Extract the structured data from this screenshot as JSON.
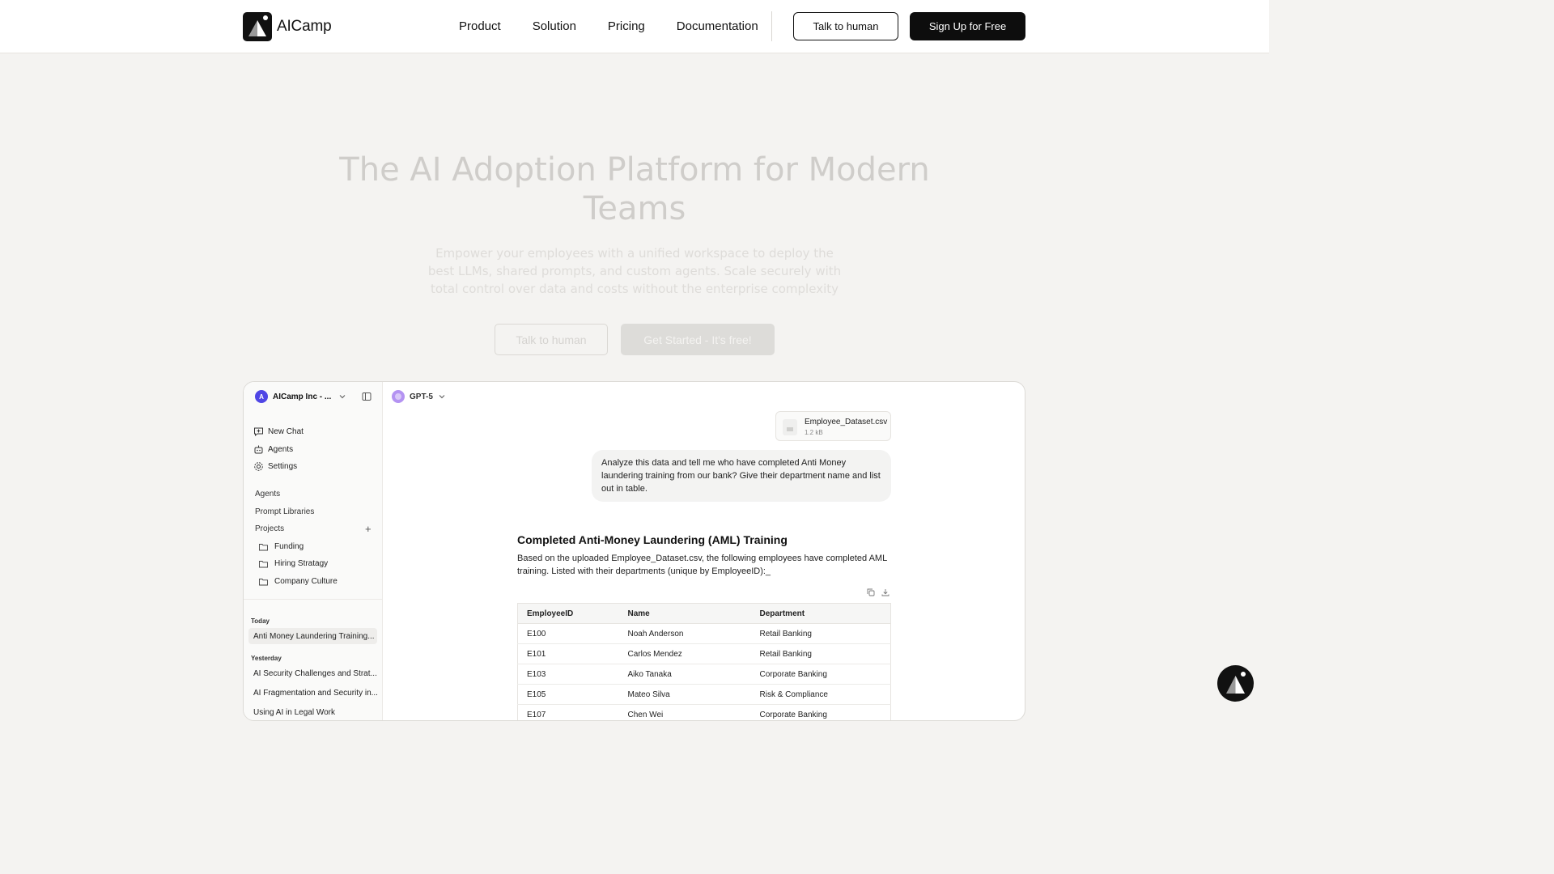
{
  "nav": {
    "brand": "AICamp",
    "links": [
      "Product",
      "Solution",
      "Pricing",
      "Documentation"
    ],
    "talk_label": "Talk to human",
    "signup_label": "Sign Up for Free"
  },
  "hero": {
    "title": "The AI Adoption Platform for Modern Teams",
    "subtitle": "Empower your employees with a unified workspace to deploy the best LLMs, shared prompts, and custom agents. Scale securely with total control over data and costs without the enterprise complexity",
    "talk_label": "Talk to human",
    "start_label": "Get Started - It's free!"
  },
  "app": {
    "workspace": "AICamp Inc - ...",
    "workspace_initial": "A",
    "nav": [
      "New Chat",
      "Agents",
      "Settings"
    ],
    "sections": [
      "Agents",
      "Prompt Libraries",
      "Projects"
    ],
    "projects": [
      "Funding",
      "Hiring Stratagy",
      "Company Culture"
    ],
    "today_label": "Today",
    "today": [
      "Anti Money Laundering Training..."
    ],
    "yesterday_label": "Yesterday",
    "yesterday": [
      "AI Security Challenges and Strat...",
      "AI Fragmentation and Security in...",
      "Using AI in Legal Work"
    ],
    "model": "GPT-5",
    "file": {
      "name": "Employee_Dataset.csv",
      "size": "1.2 kB"
    },
    "user_message": "Analyze this data and tell me who have completed Anti Money laundering training from our bank? Give their department name and list out in table.",
    "answer_title": "Completed Anti-Money Laundering (AML) Training",
    "answer_text": "Based on the uploaded Employee_Dataset.csv, the following employees have completed AML training. Listed with their departments (unique by EmployeeID):_",
    "table": {
      "headers": [
        "EmployeeID",
        "Name",
        "Department"
      ],
      "rows": [
        [
          "E100",
          "Noah Anderson",
          "Retail Banking"
        ],
        [
          "E101",
          "Carlos Mendez",
          "Retail Banking"
        ],
        [
          "E103",
          "Aiko Tanaka",
          "Corporate Banking"
        ],
        [
          "E105",
          "Mateo Silva",
          "Risk & Compliance"
        ],
        [
          "E107",
          "Chen Wei",
          "Corporate Banking"
        ]
      ]
    }
  },
  "icons": [
    "brand-logo-icon",
    "chevron-down-icon",
    "sidebar-toggle-icon",
    "new-chat-icon",
    "agents-icon",
    "settings-icon",
    "plus-icon",
    "folder-icon",
    "file-icon",
    "copy-icon",
    "download-icon",
    "chat-launcher-icon"
  ]
}
